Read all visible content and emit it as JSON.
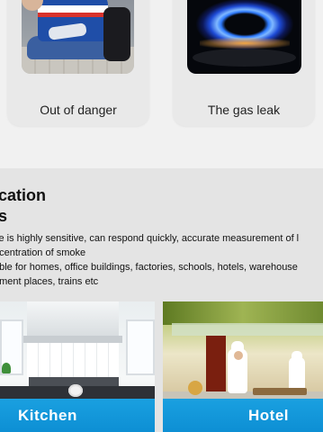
{
  "cards": [
    {
      "caption": "Out of danger",
      "image": "man-sitting-with-phone"
    },
    {
      "caption": "The gas leak",
      "image": "blue-gas-flame"
    }
  ],
  "application": {
    "title_line1": "lication",
    "title_line2": "es",
    "description_lines": [
      "ce is highly sensitive, can respond quickly, accurate measurement of l",
      "ncentration of smoke",
      "able for homes, office buildings, factories, schools, hotels, warehouse",
      "nment places, trains etc"
    ],
    "scenes": [
      {
        "label": "Kitchen"
      },
      {
        "label": "Hotel"
      }
    ]
  },
  "colors": {
    "page_bg": "#f1f1f1",
    "section_bg": "#e4e4e4",
    "card_bg": "#e9e9e9",
    "label_bar": "#1aa0e0"
  }
}
